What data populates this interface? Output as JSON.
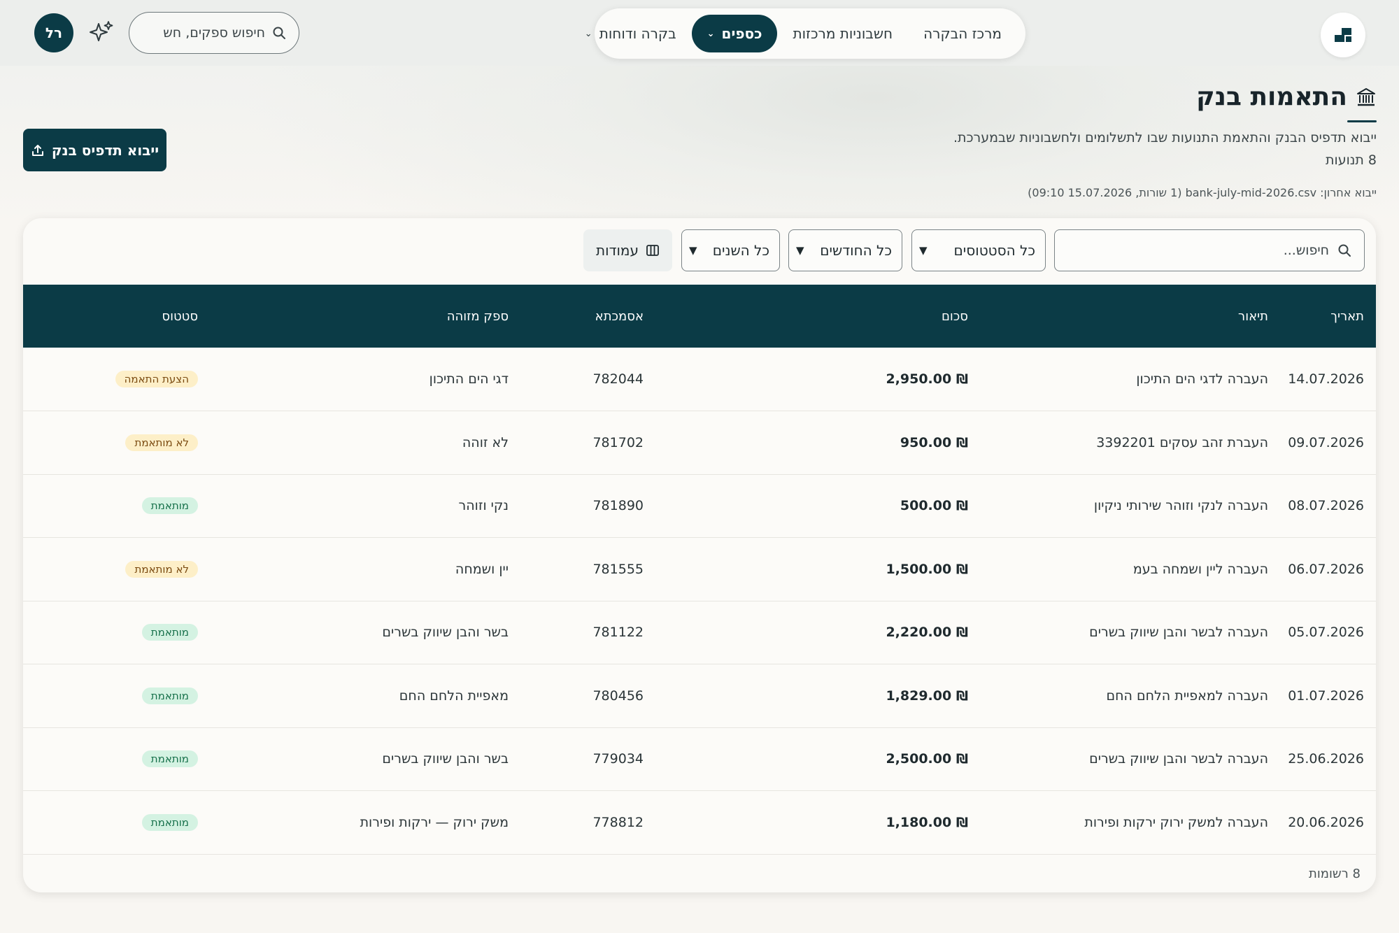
{
  "nav": {
    "items": [
      {
        "label": "מרכז הבקרה",
        "active": false,
        "has_dropdown": false
      },
      {
        "label": "חשבוניות מרכזות",
        "active": false,
        "has_dropdown": false
      },
      {
        "label": "כספים",
        "active": true,
        "has_dropdown": true
      },
      {
        "label": "בקרה ודוחות",
        "active": false,
        "has_dropdown": true
      }
    ]
  },
  "global_search": {
    "placeholder": "חיפוש ספקים, חש",
    "icon": "search-icon"
  },
  "user": {
    "initials": "רל"
  },
  "page": {
    "title": "התאמות בנק",
    "title_icon": "bank-icon",
    "subtitle": "ייבוא תדפיס הבנק והתאמת התנועות שבו לתשלומים ולחשבוניות שבמערכת.",
    "count": "8 תנועות",
    "last_import": "ייבוא אחרון: bank-july-mid-2026.csv (1 שורות, 15.07.2026 09:10)",
    "import_button": "ייבוא תדפיס בנק"
  },
  "toolbar": {
    "search_placeholder": "חיפוש...",
    "status_filter": "כל הסטטוסים",
    "month_filter": "כל החודשים",
    "year_filter": "כל השנים",
    "columns_button": "עמודות"
  },
  "table": {
    "headers": {
      "date": "תאריך",
      "description": "תיאור",
      "amount": "סכום",
      "reference": "אסמכתא",
      "vendor": "ספק מזוהה",
      "status": "סטטוס"
    },
    "rows": [
      {
        "date": "14.07.2026",
        "description": "העברה לדגי הים התיכון",
        "amount": "₪ 2,950.00",
        "reference": "782044",
        "vendor": "דגי הים התיכון",
        "status": "הצעת התאמה",
        "status_type": "suggest"
      },
      {
        "date": "09.07.2026",
        "description": "העברת זהב עסקים 3392201",
        "amount": "₪ 950.00",
        "reference": "781702",
        "vendor": "לא זוהה",
        "status": "לא מותאמת",
        "status_type": "unmatched"
      },
      {
        "date": "08.07.2026",
        "description": "העברה לנקי וזוהר שירותי ניקיון",
        "amount": "₪ 500.00",
        "reference": "781890",
        "vendor": "נקי וזוהר",
        "status": "מותאמת",
        "status_type": "matched"
      },
      {
        "date": "06.07.2026",
        "description": "העברה ליין ושמחה בעמ",
        "amount": "₪ 1,500.00",
        "reference": "781555",
        "vendor": "יין ושמחה",
        "status": "לא מותאמת",
        "status_type": "unmatched"
      },
      {
        "date": "05.07.2026",
        "description": "העברה לבשר והבן שיווק בשרים",
        "amount": "₪ 2,220.00",
        "reference": "781122",
        "vendor": "בשר והבן שיווק בשרים",
        "status": "מותאמת",
        "status_type": "matched"
      },
      {
        "date": "01.07.2026",
        "description": "העברה למאפיית הלחם החם",
        "amount": "₪ 1,829.00",
        "reference": "780456",
        "vendor": "מאפיית הלחם החם",
        "status": "מותאמת",
        "status_type": "matched"
      },
      {
        "date": "25.06.2026",
        "description": "העברה לבשר והבן שיווק בשרים",
        "amount": "₪ 2,500.00",
        "reference": "779034",
        "vendor": "בשר והבן שיווק בשרים",
        "status": "מותאמת",
        "status_type": "matched"
      },
      {
        "date": "20.06.2026",
        "description": "העברה למשק ירוק ירקות ופירות",
        "amount": "₪ 1,180.00",
        "reference": "778812",
        "vendor": "משק ירוק — ירקות ופירות",
        "status": "מותאמת",
        "status_type": "matched"
      }
    ]
  },
  "footer": {
    "records": "8 רשומות"
  },
  "colors": {
    "primary": "#0b3b46",
    "matched_bg": "#d4f2e2",
    "unmatched_bg": "#fdefc8"
  }
}
